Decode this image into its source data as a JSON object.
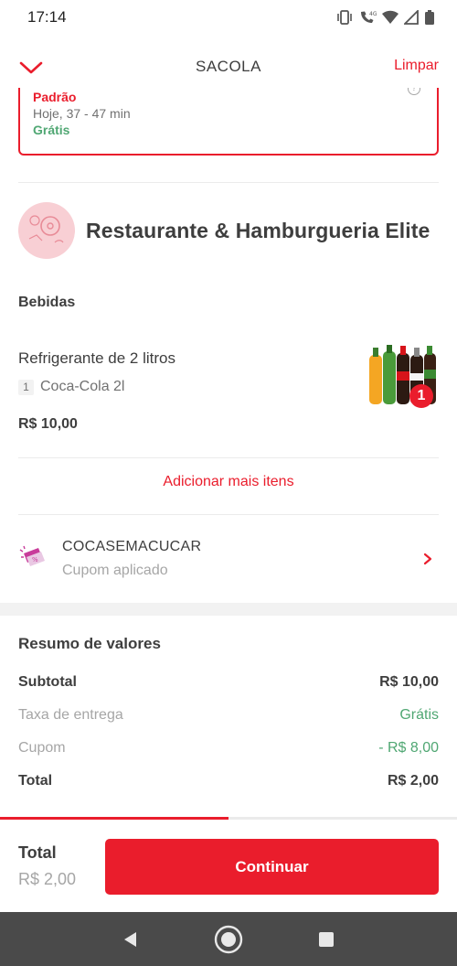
{
  "status_bar": {
    "time": "17:14",
    "icons": [
      "vibrate-icon",
      "call-4g-icon",
      "wifi-icon",
      "signal-icon",
      "battery-icon"
    ]
  },
  "header": {
    "title": "SACOLA",
    "clear_label": "Limpar",
    "back_icon": "chevron-down-icon"
  },
  "delivery": {
    "option_label": "Padrão",
    "eta": "Hoje, 37 - 47 min",
    "fee": "Grátis"
  },
  "restaurant": {
    "name": "Restaurante & Hamburgueria Elite"
  },
  "cart": {
    "category": "Bebidas",
    "items": [
      {
        "name": "Refrigerante de 2 litros",
        "quantity": "1",
        "option": "Coca-Cola 2l",
        "price": "R$ 10,00",
        "badge": "1"
      }
    ],
    "add_more_label": "Adicionar mais itens"
  },
  "coupon": {
    "code": "COCASEMACUCAR",
    "status": "Cupom aplicado"
  },
  "summary": {
    "title": "Resumo de valores",
    "rows": [
      {
        "label": "Subtotal",
        "value": "R$ 10,00"
      },
      {
        "label": "Taxa de entrega",
        "value": "Grátis"
      },
      {
        "label": "Cupom",
        "value": "- R$ 8,00"
      },
      {
        "label": "Total",
        "value": "R$ 2,00"
      }
    ]
  },
  "footer": {
    "total_label": "Total",
    "total_value": "R$ 2,00",
    "continue_label": "Continuar",
    "progress": 0.5
  },
  "colors": {
    "accent": "#ea1d2c",
    "success": "#50a773",
    "text": "#3e3e3e",
    "muted": "#a6a6a6"
  }
}
